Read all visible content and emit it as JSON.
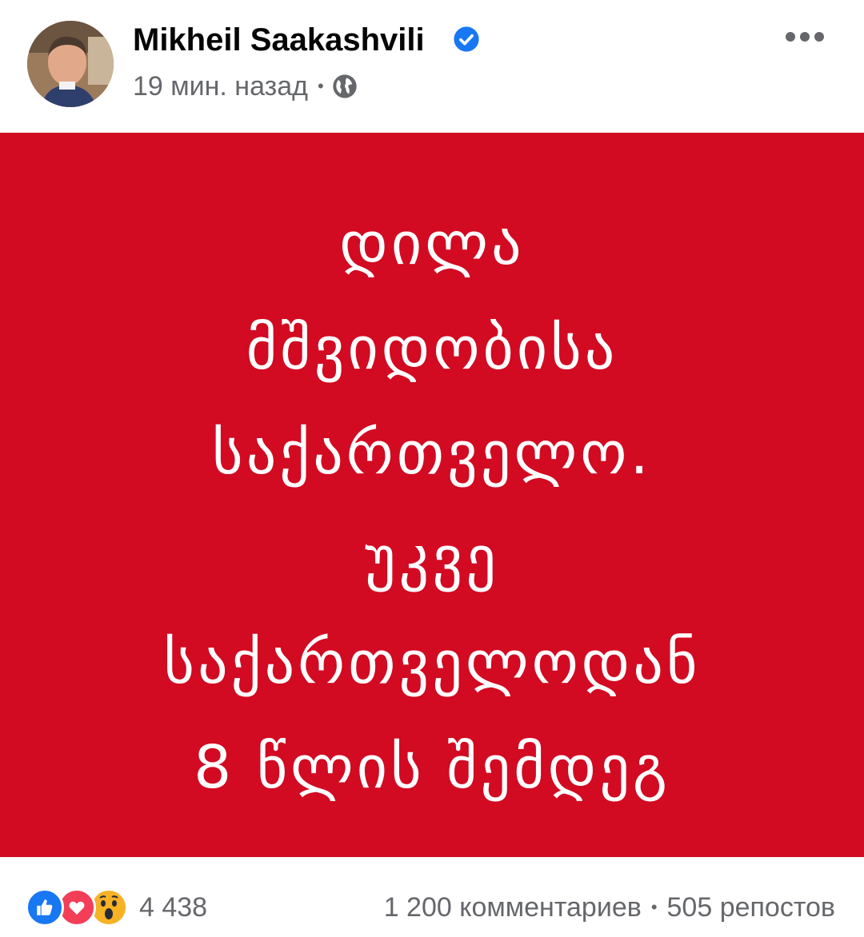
{
  "post": {
    "author": "Mikheil Saakashvili",
    "timestamp": "19 мин. назад",
    "separator": "•",
    "privacy_icon": "globe-icon",
    "verified_icon": "verified-badge-icon",
    "more_icon": "more-options-icon"
  },
  "image": {
    "background_color": "#d20a22",
    "text_color": "#ffffff",
    "lines": [
      "დილა",
      "მშვიდობისა",
      "საქართველო.",
      "უკვე",
      "საქართველოდან",
      "8 წლის შემდეგ"
    ]
  },
  "footer": {
    "reactions": [
      "like-icon",
      "love-icon",
      "wow-icon"
    ],
    "reaction_count": "4 438",
    "comments": "1 200 комментариев",
    "separator": "•",
    "shares": "505 репостов"
  },
  "colors": {
    "like": "#1877f2",
    "love": "#f33e58",
    "wow": "#f7b125",
    "verified": "#1877f2",
    "secondary_text": "#65676b"
  }
}
